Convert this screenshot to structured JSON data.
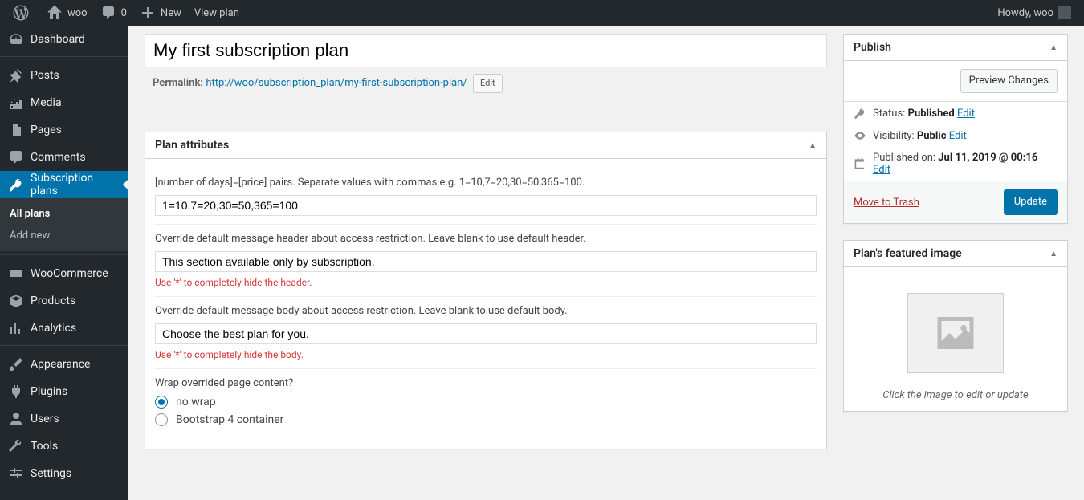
{
  "adminbar": {
    "site_name": "woo",
    "comments_count": "0",
    "new_label": "New",
    "view_label": "View plan",
    "howdy_prefix": "Howdy, ",
    "howdy_user": "woo"
  },
  "sidebar": {
    "items": [
      {
        "label": "Dashboard",
        "icon": "dashboard"
      },
      {
        "label": "Posts",
        "icon": "pin"
      },
      {
        "label": "Media",
        "icon": "media"
      },
      {
        "label": "Pages",
        "icon": "page"
      },
      {
        "label": "Comments",
        "icon": "comment"
      },
      {
        "label": "Subscription plans",
        "icon": "key",
        "current": true
      },
      {
        "label": "WooCommerce",
        "icon": "woo"
      },
      {
        "label": "Products",
        "icon": "box"
      },
      {
        "label": "Analytics",
        "icon": "chart"
      },
      {
        "label": "Appearance",
        "icon": "brush"
      },
      {
        "label": "Plugins",
        "icon": "plug"
      },
      {
        "label": "Users",
        "icon": "user"
      },
      {
        "label": "Tools",
        "icon": "wrench"
      },
      {
        "label": "Settings",
        "icon": "sliders"
      }
    ],
    "submenu": [
      {
        "label": "All plans",
        "current": true
      },
      {
        "label": "Add new"
      }
    ]
  },
  "editor": {
    "title_value": "My first subscription plan",
    "permalink_label": "Permalink:",
    "permalink_url": "http://woo/subscription_plan/my-first-subscription-plan/",
    "permalink_edit": "Edit"
  },
  "plan_attributes": {
    "box_title": "Plan attributes",
    "pairs_label": "[number of days]=[price] pairs. Separate values with commas e.g. 1=10,7=20,30=50,365=100.",
    "pairs_value": "1=10,7=20,30=50,365=100",
    "header_override_label": "Override default message header about access restriction. Leave blank to use default header.",
    "header_override_value": "This section available only by subscription.",
    "header_hint": "Use '*' to completely hide the header.",
    "body_override_label": "Override default message body about access restriction. Leave blank to use default body.",
    "body_override_value": "Choose the best plan for you.",
    "body_hint": "Use '*' to completely hide the body.",
    "wrap_label": "Wrap overrided page content?",
    "wrap_options": [
      {
        "label": "no wrap",
        "checked": true
      },
      {
        "label": "Bootstrap 4 container",
        "checked": false
      }
    ]
  },
  "publish": {
    "box_title": "Publish",
    "preview_label": "Preview Changes",
    "status_label": "Status:",
    "status_value": "Published",
    "visibility_label": "Visibility:",
    "visibility_value": "Public",
    "published_label": "Published on:",
    "published_value": "Jul 11, 2019 @ 00:16",
    "edit_label": "Edit",
    "trash_label": "Move to Trash",
    "update_label": "Update"
  },
  "featured": {
    "box_title": "Plan's featured image",
    "hint": "Click the image to edit or update"
  }
}
